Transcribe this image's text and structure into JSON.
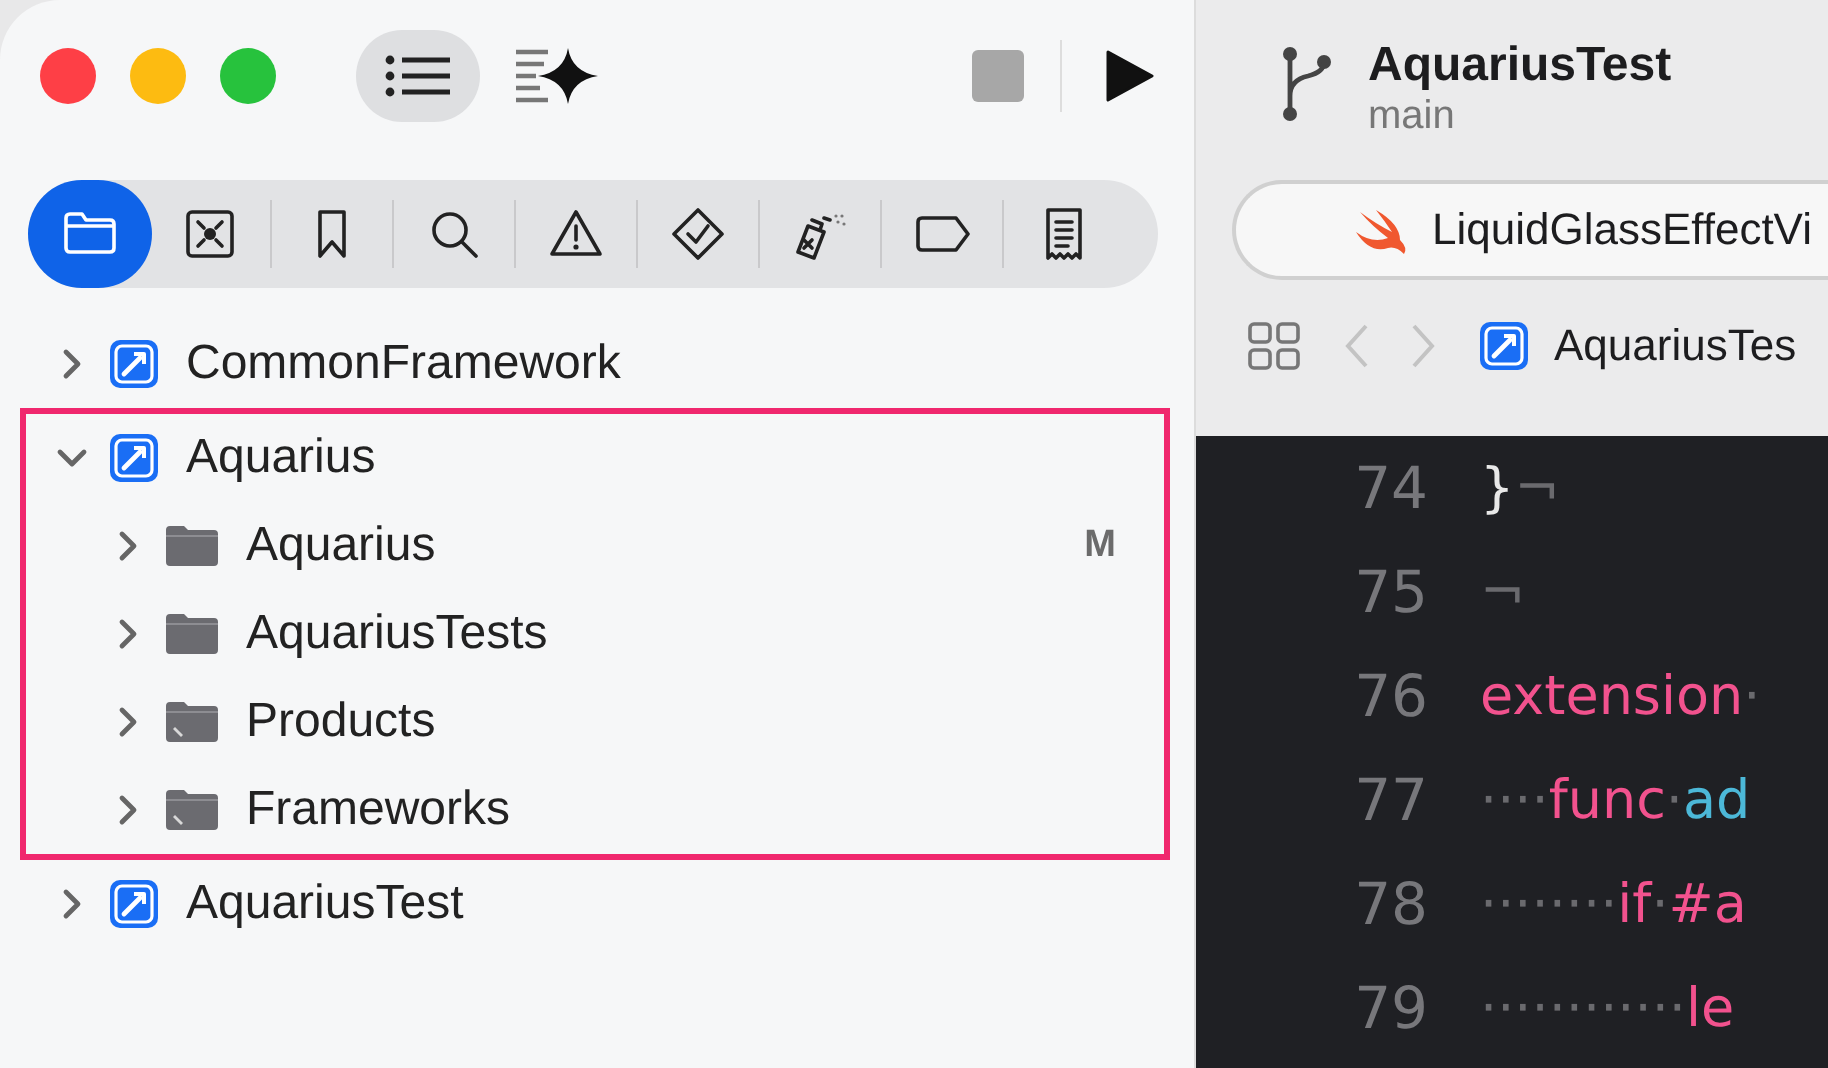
{
  "window": {
    "toolbar": {
      "navigator_toggle": {
        "selected": true
      }
    }
  },
  "navigator_tabs": [
    {
      "selected": true
    },
    {
      "selected": false
    },
    {
      "selected": false
    },
    {
      "selected": false
    },
    {
      "selected": false
    },
    {
      "selected": false
    },
    {
      "selected": false
    },
    {
      "selected": false
    },
    {
      "selected": false
    }
  ],
  "tree": [
    {
      "label": "CommonFramework",
      "kind": "project",
      "expanded": false,
      "highlighted": false
    },
    {
      "label": "Aquarius",
      "kind": "project",
      "expanded": true,
      "highlighted": true,
      "children": [
        {
          "label": "Aquarius",
          "kind": "folder",
          "expanded": false,
          "status": "M"
        },
        {
          "label": "AquariusTests",
          "kind": "folder",
          "expanded": false
        },
        {
          "label": "Products",
          "kind": "group",
          "expanded": false
        },
        {
          "label": "Frameworks",
          "kind": "group",
          "expanded": false
        }
      ]
    },
    {
      "label": "AquariusTest",
      "kind": "project",
      "expanded": false,
      "highlighted": false
    }
  ],
  "project": {
    "title": "AquariusTest",
    "branch": "main"
  },
  "scheme": {
    "label": "LiquidGlassEffectVi"
  },
  "jump_bar": {
    "label": "AquariusTes"
  },
  "editor": {
    "lines": [
      {
        "number": "74",
        "tokens": [
          {
            "kind": "plain",
            "text": "}"
          },
          {
            "kind": "invisible",
            "text": "¬"
          }
        ]
      },
      {
        "number": "75",
        "tokens": [
          {
            "kind": "invisible",
            "text": "¬"
          }
        ]
      },
      {
        "number": "76",
        "tokens": [
          {
            "kind": "keyword",
            "text": "extension"
          },
          {
            "kind": "invisible",
            "text": "·"
          }
        ]
      },
      {
        "number": "77",
        "tokens": [
          {
            "kind": "invisible",
            "text": "····"
          },
          {
            "kind": "keyword",
            "text": "func"
          },
          {
            "kind": "invisible",
            "text": "·"
          },
          {
            "kind": "identifier",
            "text": "ad"
          }
        ]
      },
      {
        "number": "78",
        "tokens": [
          {
            "kind": "invisible",
            "text": "········"
          },
          {
            "kind": "keyword",
            "text": "if"
          },
          {
            "kind": "invisible",
            "text": "·"
          },
          {
            "kind": "keyword",
            "text": "#a"
          }
        ]
      },
      {
        "number": "79",
        "tokens": [
          {
            "kind": "invisible",
            "text": "············"
          },
          {
            "kind": "keyword",
            "text": "le"
          }
        ]
      }
    ]
  }
}
